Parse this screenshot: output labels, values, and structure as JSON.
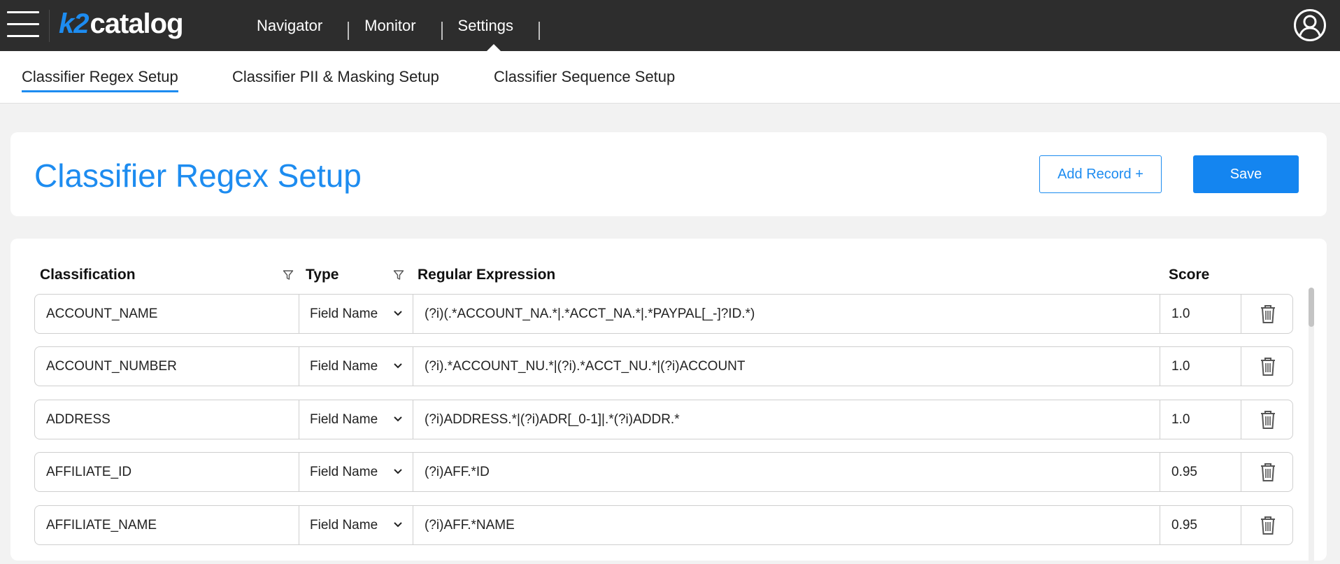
{
  "app": {
    "logo_k2": "k2",
    "logo_catalog": "catalog"
  },
  "nav": {
    "items": [
      {
        "label": "Navigator"
      },
      {
        "label": "Monitor"
      },
      {
        "label": "Settings",
        "active": true
      }
    ]
  },
  "subtabs": [
    {
      "label": "Classifier Regex Setup",
      "active": true
    },
    {
      "label": "Classifier PII & Masking Setup"
    },
    {
      "label": "Classifier Sequence Setup"
    }
  ],
  "header": {
    "title": "Classifier Regex Setup",
    "add_record_label": "Add Record +",
    "save_label": "Save"
  },
  "table": {
    "columns": {
      "classification": "Classification",
      "type": "Type",
      "regex": "Regular Expression",
      "score": "Score"
    },
    "rows": [
      {
        "classification": "ACCOUNT_NAME",
        "type": "Field Name",
        "regex": "(?i)(.*ACCOUNT_NA.*|.*ACCT_NA.*|.*PAYPAL[_-]?ID.*)",
        "score": "1.0"
      },
      {
        "classification": "ACCOUNT_NUMBER",
        "type": "Field Name",
        "regex": "(?i).*ACCOUNT_NU.*|(?i).*ACCT_NU.*|(?i)ACCOUNT",
        "score": "1.0"
      },
      {
        "classification": "ADDRESS",
        "type": "Field Name",
        "regex": "(?i)ADDRESS.*|(?i)ADR[_0-1]|.*(?i)ADDR.*",
        "score": "1.0"
      },
      {
        "classification": "AFFILIATE_ID",
        "type": "Field Name",
        "regex": "(?i)AFF.*ID",
        "score": "0.95"
      },
      {
        "classification": "AFFILIATE_NAME",
        "type": "Field Name",
        "regex": "(?i)AFF.*NAME",
        "score": "0.95"
      }
    ]
  },
  "colors": {
    "accent": "#1d8cf0",
    "topbar": "#2d2d2d",
    "background": "#f2f2f2"
  },
  "icons": {
    "menu": "hamburger-icon",
    "profile": "user-profile-icon",
    "filter": "filter-icon",
    "dropdown": "chevron-down-icon",
    "delete": "trash-icon"
  }
}
